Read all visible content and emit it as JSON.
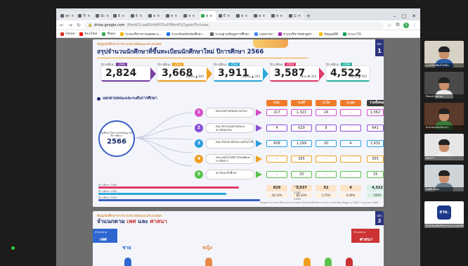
{
  "browser": {
    "tabs": [
      {
        "label": "en"
      },
      {
        "label": "Tr"
      },
      {
        "label": "Sc"
      },
      {
        "label": "6"
      },
      {
        "label": "6"
      },
      {
        "label": "ห"
      },
      {
        "label": "ห"
      },
      {
        "label": "ห"
      },
      {
        "label": "ห",
        "active": true
      },
      {
        "label": "E"
      },
      {
        "label": "ห"
      },
      {
        "label": "ต"
      },
      {
        "label": "ห"
      },
      {
        "label": "G"
      }
    ],
    "new_tab": "+",
    "url_host": "drive.google.com",
    "url_path": "/file/d/1l-aeBlVd4Pl35uFPBmHSj7gpbnTln/view",
    "bookmarks": [
      {
        "label": "Gmail",
        "color": "#d93025"
      },
      {
        "label": "YouTube",
        "color": "#ff0000"
      },
      {
        "label": "Maps",
        "color": "#34a853"
      },
      {
        "label": "ระบบบริหารงานบุคคล ม...",
        "color": "#f4b400"
      },
      {
        "label": "ระบบรับสมัครนักศึกษา...",
        "color": "#1a73e8"
      },
      {
        "label": "ระบบฐานข้อมูลการศึกษา",
        "color": "#5f6368"
      },
      {
        "label": "แปลภาษา",
        "color": "#4285f4"
      },
      {
        "label": "ระบบบริหารหลักสูตร...",
        "color": "#9c27b0"
      },
      {
        "label": "ข้อมูลสถิติ",
        "color": "#fbbc04"
      },
      {
        "label": "ระบบ ITA",
        "color": "#0f9d58"
      }
    ],
    "profile_initial": "S"
  },
  "slide1": {
    "eyebrow": "ข้อมูลนักศึกษาจากระบบทะเบียนและประมวลผล",
    "title": "สรุปจำนวนนักศึกษาที่ขึ้นทะเบียนนักศึกษาใหม่ ปีการศึกษา 2566",
    "page_label": "หน้า",
    "page_number": "1",
    "stats": [
      {
        "label": "ปีการศึกษา",
        "year": "2562",
        "value": "2,824",
        "delta": "",
        "color": "#7b3fa0"
      },
      {
        "label": "ปีการศึกษา",
        "year": "2563",
        "value": "3,668",
        "delta": "เพิ่มขึ้น ▲ 844",
        "color": "#f0a020"
      },
      {
        "label": "ปีการศึกษา",
        "year": "2564",
        "value": "3,911",
        "delta": "เพิ่มขึ้น ▲ 243",
        "color": "#2aa8d8"
      },
      {
        "label": "ปีการศึกษา",
        "year": "2565",
        "value": "3,587",
        "delta": "ลดลง ▼ 324",
        "color": "#e03b6a"
      },
      {
        "label": "ปีการศึกษา",
        "year": "2566",
        "value": "4,522",
        "delta": "เพิ่มขึ้น ▲ 935",
        "color": "#28b4a0"
      }
    ],
    "section_title": "แยกตามคณะและระดับการศึกษา",
    "ring_caption": "นักศึกษาใหม่ระดับปริญญาตรี ปีการศึกษา",
    "ring_value": "2566",
    "columns": [
      {
        "label": "ปวส.",
        "color": "#f07b2a"
      },
      {
        "label": "ป.ตรี",
        "color": "#f07b2a"
      },
      {
        "label": "ป.โท",
        "color": "#f07b2a"
      },
      {
        "label": "ป.เอก",
        "color": "#f07b2a"
      },
      {
        "label": "รวมทั้งหมด",
        "color": "#3a3a3a"
      }
    ],
    "rows": [
      {
        "no": "1",
        "faculty": "คณะครุศาสตร์อุตสาหกรรม",
        "color": "#d64fc9",
        "vals": [
          "217",
          "1,321",
          "24",
          "-"
        ],
        "total": "1,562",
        "pct": "34.54%"
      },
      {
        "no": "2",
        "faculty": "คณะวิศวกรรมศาสตร์และสถาปัตยกรรม",
        "color": "#8a4fd6",
        "vals": [
          "4",
          "629",
          "8",
          "-"
        ],
        "total": "641",
        "pct": "14.18%"
      },
      {
        "no": "3",
        "faculty": "คณะวิทยาศาสตร์และเทคโนโลยี",
        "color": "#2a9ee0",
        "vals": [
          "608",
          "1,299",
          "20",
          "4"
        ],
        "total": "1,931",
        "pct": "42.70%"
      },
      {
        "no": "4",
        "faculty": "คณะเทคโนโลยีสารสนเทศและการสื่อสาร",
        "color": "#f0a020",
        "vals": [
          "-",
          "355",
          "-",
          "-"
        ],
        "total": "355",
        "pct": "7.85%"
      },
      {
        "no": "5",
        "faculty": "สถาบันอาชีวศึกษา",
        "color": "#5bc24a",
        "vals": [
          "-",
          "33",
          "-",
          "-"
        ],
        "total": "33",
        "pct": "0.73%"
      }
    ],
    "sums": [
      "829",
      "3,637",
      "52",
      "4",
      "4,522"
    ],
    "sum_pcts": [
      "18.33%",
      "80.43%",
      "1.15%",
      "0.09%",
      "100%"
    ],
    "bars": [
      {
        "label": "ปีการศึกษา 2566",
        "value": "3,911",
        "fraction": 0.87,
        "color": "#e03b6a"
      },
      {
        "label": "ปีการศึกษา 2565",
        "value": "3,587",
        "fraction": 0.79,
        "color": "#2aa8d8"
      },
      {
        "label": "ปีการศึกษา 2564",
        "value": "4,522",
        "fraction": 1.0,
        "color": "#3b5fc7"
      }
    ],
    "footnote": "ข้อมูลจากระบบทะเบียนและประมวลผล สำนักส่งเสริมวิชาการและงานทะเบียน ข้อมูล ณ วันที่ 1 กรกฎาคม 2566"
  },
  "slide2": {
    "eyebrow": "ข้อมูลนักศึกษาจากระบบทะเบียนและประมวลผล",
    "title_a": "จำแนกตาม ",
    "title_b": "เพศ",
    "title_c": " และ ",
    "title_d": "ศาสนา",
    "page_label": "หน้า",
    "page_number": "2",
    "left_key": "จำแนกตาม",
    "left_val": "เพศ",
    "right_key": "จำแนกตาม",
    "right_val": "ศาสนา",
    "male": "ชาย",
    "female": "หญิง"
  },
  "participants": [
    {
      "name": "นายเกียรติศักดิ์ ทับทิม"
    },
    {
      "name": "Pascal Labrau"
    },
    {
      "name": "สำนักส่งเสริมวิชาการ"
    },
    {
      "name": "RMUTT"
    },
    {
      "name": "อนุชิต ศรีสุข"
    },
    {
      "name": "สำนักส่งเสริมวิชาการและงานทะเบียน",
      "logo": "สวท."
    }
  ]
}
